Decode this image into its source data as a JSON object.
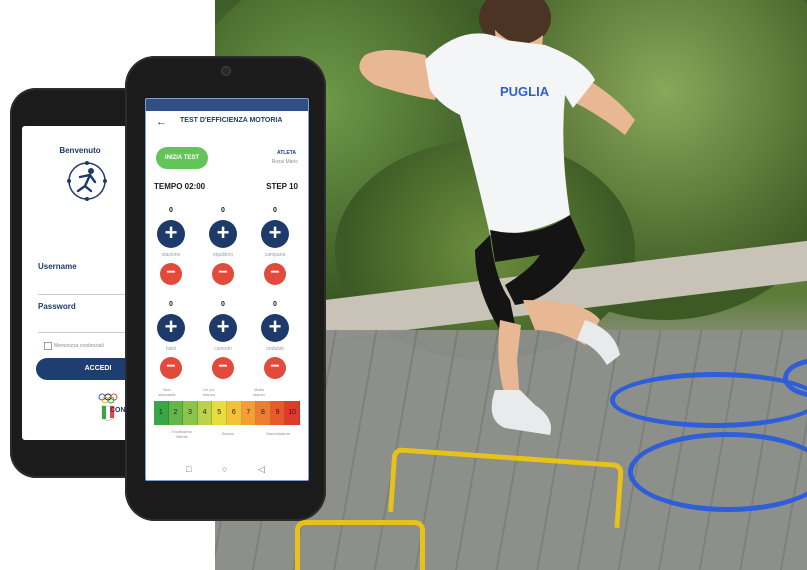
{
  "login_screen": {
    "welcome": "Benvenuto",
    "username_label": "Username",
    "password_label": "Password",
    "remember_label": "Memorizza credenziali",
    "login_button": "ACCEDI",
    "coni_label": "CONI"
  },
  "test_screen": {
    "header_title": "TEST D'EFFICIENZA MOTORIA",
    "start_button": "INIZIA TEST",
    "athlete_label": "ATLETA",
    "athlete_name": "Rossi Mario",
    "timer": "TEMPO 02:00",
    "step": "STEP 10",
    "stations": [
      {
        "count": "0",
        "name": "stazione"
      },
      {
        "count": "0",
        "name": "equilibrio"
      },
      {
        "count": "0",
        "name": "campana"
      },
      {
        "count": "0",
        "name": "balzi"
      },
      {
        "count": "0",
        "name": "canestri"
      },
      {
        "count": "0",
        "name": "ondulati"
      }
    ],
    "plus_symbol": "+",
    "minus_symbol": "−",
    "scale_top": [
      "Non stancante",
      "Un po' stanco",
      "Molto stanco"
    ],
    "scale_values": [
      "1",
      "2",
      "3",
      "4",
      "5",
      "6",
      "7",
      "8",
      "9",
      "10"
    ],
    "scale_colors": [
      "#3aa547",
      "#63b74a",
      "#8cc34a",
      "#bdd248",
      "#e9dd3e",
      "#f4c238",
      "#f2a033",
      "#ee7d2f",
      "#e85a2b",
      "#df3b2a"
    ],
    "scale_bottom": [
      "Facilissimo Niente",
      "Stanco",
      "Stanchissimo"
    ]
  },
  "photo": {
    "shirt_text": "PUGLIA"
  },
  "colors": {
    "navy": "#1e3a6b",
    "green_button": "#63c45a",
    "minus_red": "#e24b3b"
  }
}
